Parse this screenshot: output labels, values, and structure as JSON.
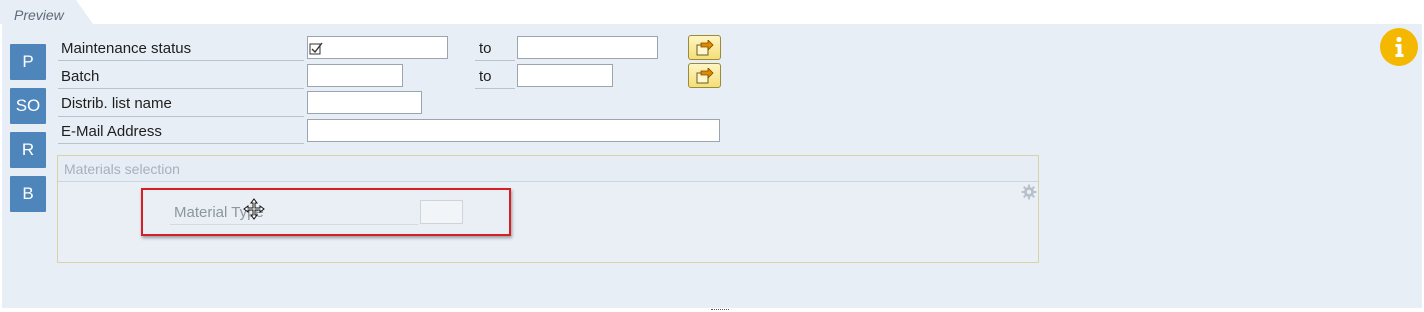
{
  "tab": {
    "label": "Preview"
  },
  "side_buttons": [
    {
      "label": "P"
    },
    {
      "label": "SO"
    },
    {
      "label": "R"
    },
    {
      "label": "B"
    }
  ],
  "fields": {
    "maintenance_status": {
      "label": "Maintenance status",
      "checked": true,
      "to_label": "to",
      "to_value": ""
    },
    "batch": {
      "label": "Batch",
      "value": "",
      "to_label": "to",
      "to_value": ""
    },
    "distrib_list_name": {
      "label": "Distrib. list name",
      "value": ""
    },
    "email_address": {
      "label": "E-Mail Address",
      "value": ""
    }
  },
  "materials_selection": {
    "title": "Materials selection",
    "material_type": {
      "label": "Material Type",
      "value": ""
    }
  },
  "icons": {
    "multiple_selection": "arrow-right-into-folder-icon",
    "info": "info-icon",
    "settings": "gear-icon",
    "cursor": "move-cursor-icon"
  },
  "colors": {
    "side_button": "#4e86bc",
    "panel_background": "#e8eef5",
    "info_button": "#f5b800",
    "highlight_frame": "#d61f26",
    "multi_button": "#f5df77"
  }
}
